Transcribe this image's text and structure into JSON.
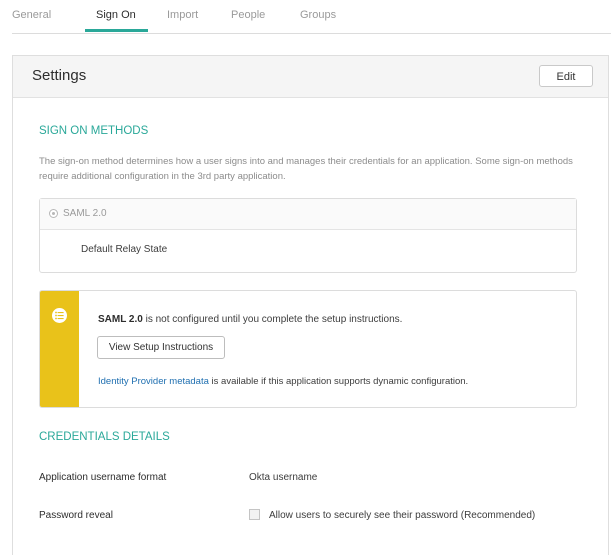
{
  "tabs": [
    {
      "label": "General",
      "active": false
    },
    {
      "label": "Sign On",
      "active": true
    },
    {
      "label": "Import",
      "active": false
    },
    {
      "label": "People",
      "active": false
    },
    {
      "label": "Groups",
      "active": false
    }
  ],
  "settings": {
    "title": "Settings",
    "edit_label": "Edit"
  },
  "sign_on_methods": {
    "heading": "SIGN ON METHODS",
    "description": "The sign-on method determines how a user signs into and manages their credentials for an application. Some sign-on methods require additional configuration in the 3rd party application.",
    "method_label": "SAML 2.0",
    "relay_state_label": "Default Relay State"
  },
  "notice": {
    "method_bold": "SAML 2.0",
    "message_rest": " is not configured until you complete the setup instructions.",
    "setup_button_label": "View Setup Instructions",
    "metadata_link": "Identity Provider metadata",
    "metadata_rest": " is available if this application supports dynamic configuration."
  },
  "credentials": {
    "heading": "CREDENTIALS DETAILS",
    "username_format_label": "Application username format",
    "username_format_value": "Okta username",
    "password_reveal_label": "Password reveal",
    "password_reveal_checkbox_label": "Allow users to securely see their password (Recommended)",
    "password_reveal_checked": false
  },
  "colors": {
    "accent": "#2aa899",
    "warning": "#e9c21a",
    "link": "#1f6fb0"
  }
}
